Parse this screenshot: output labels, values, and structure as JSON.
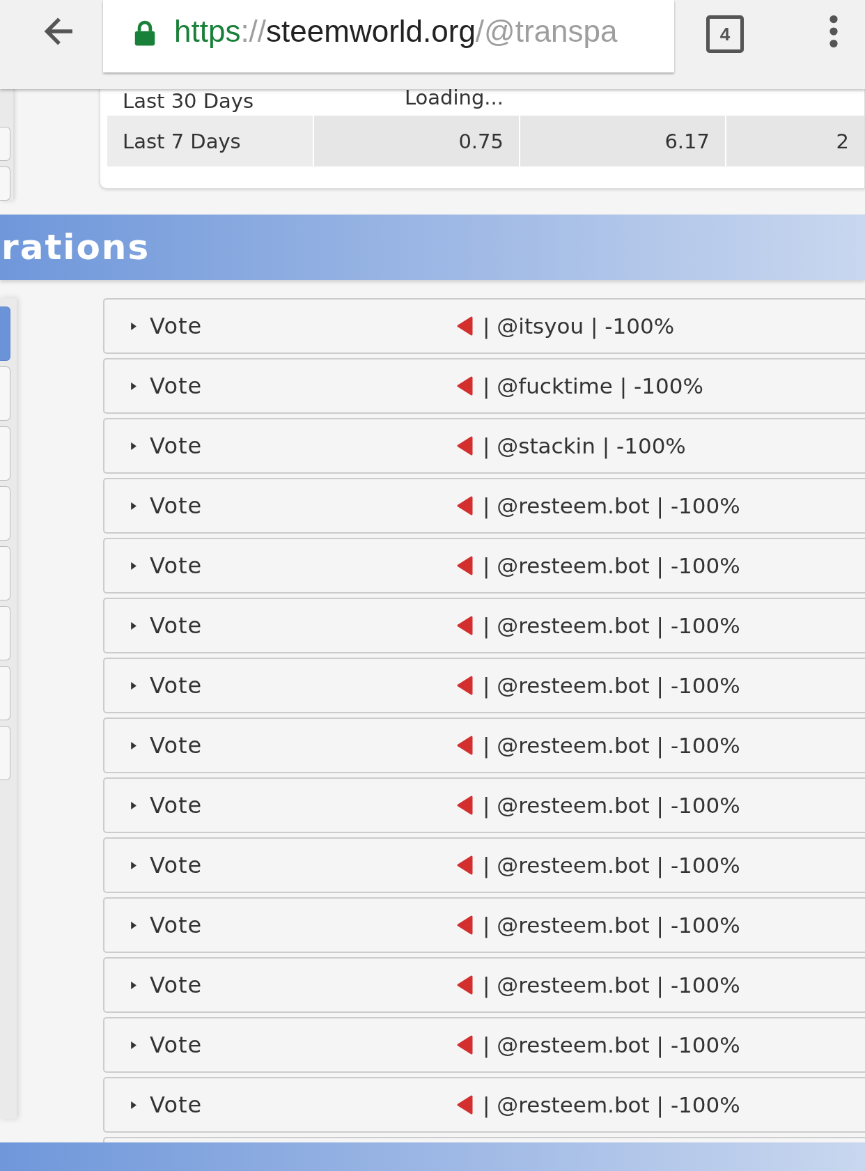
{
  "browser": {
    "url": {
      "scheme": "https",
      "separator": "://",
      "host": "steemworld.org",
      "path": "/@transpa"
    },
    "tab_count": "4"
  },
  "stats_table": {
    "rows": [
      {
        "label": "Last 30 Days",
        "cells": [
          "Loading...",
          "",
          ""
        ]
      },
      {
        "label": "Last 7 Days",
        "cells": [
          "0.75",
          "6.17",
          "2"
        ]
      }
    ]
  },
  "section": {
    "title": "rations"
  },
  "sidebar": {
    "items": [
      {
        "selected": true
      },
      {
        "selected": false
      },
      {
        "selected": false
      },
      {
        "selected": false
      },
      {
        "selected": false
      },
      {
        "selected": false
      },
      {
        "selected": false
      },
      {
        "selected": false
      }
    ]
  },
  "operations": [
    {
      "type": "Vote",
      "detail": "| @itsyou | -100%",
      "expanded": false
    },
    {
      "type": "Vote",
      "detail": "| @fucktime | -100%",
      "expanded": false
    },
    {
      "type": "Vote",
      "detail": "| @stackin | -100%",
      "expanded": false
    },
    {
      "type": "Vote",
      "detail": "| @resteem.bot | -100%",
      "expanded": false
    },
    {
      "type": "Vote",
      "detail": "| @resteem.bot | -100%",
      "expanded": false
    },
    {
      "type": "Vote",
      "detail": "| @resteem.bot | -100%",
      "expanded": false
    },
    {
      "type": "Vote",
      "detail": "| @resteem.bot | -100%",
      "expanded": false
    },
    {
      "type": "Vote",
      "detail": "| @resteem.bot | -100%",
      "expanded": false
    },
    {
      "type": "Vote",
      "detail": "| @resteem.bot | -100%",
      "expanded": false
    },
    {
      "type": "Vote",
      "detail": "| @resteem.bot | -100%",
      "expanded": false
    },
    {
      "type": "Vote",
      "detail": "| @resteem.bot | -100%",
      "expanded": false
    },
    {
      "type": "Vote",
      "detail": "| @resteem.bot | -100%",
      "expanded": false
    },
    {
      "type": "Vote",
      "detail": "| @resteem.bot | -100%",
      "expanded": false
    },
    {
      "type": "Vote",
      "detail": "| @resteem.bot | -100%",
      "expanded": false
    }
  ]
}
